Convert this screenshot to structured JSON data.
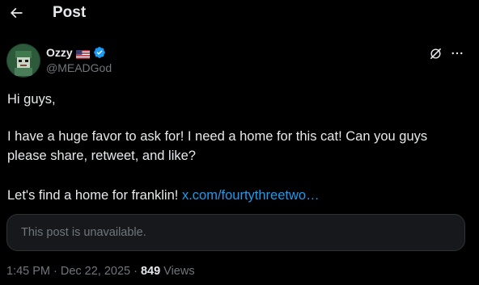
{
  "header": {
    "title": "Post",
    "back_icon": "arrow-left-icon"
  },
  "author": {
    "name": "Ozzy",
    "flag_icon": "us-flag-icon",
    "verified_icon": "verified-badge-icon",
    "handle": "@MEADGod",
    "avatar_icon": "avatar-image"
  },
  "actions": {
    "grok_icon": "grok-icon",
    "more_icon": "more-horizontal-icon"
  },
  "post": {
    "line1": "Hi guys,",
    "line2": "I have a huge favor to ask for! I need a home for this cat! Can you guys please share, retweet, and like?",
    "line3_text": "Let's find a home for franklin! ",
    "line3_link": "x.com/fourtythreetwo…"
  },
  "quote": {
    "text": "This post is unavailable."
  },
  "meta": {
    "time": "1:45 PM",
    "date": "Dec 22, 2025",
    "views_count": "849",
    "views_label": "Views",
    "sep": "·"
  },
  "colors": {
    "background": "#000000",
    "text": "#e7e9ea",
    "muted": "#71767b",
    "link": "#1d9bf0",
    "card_bg": "#16181c",
    "border": "#2f3336",
    "verified": "#1d9bf0"
  }
}
